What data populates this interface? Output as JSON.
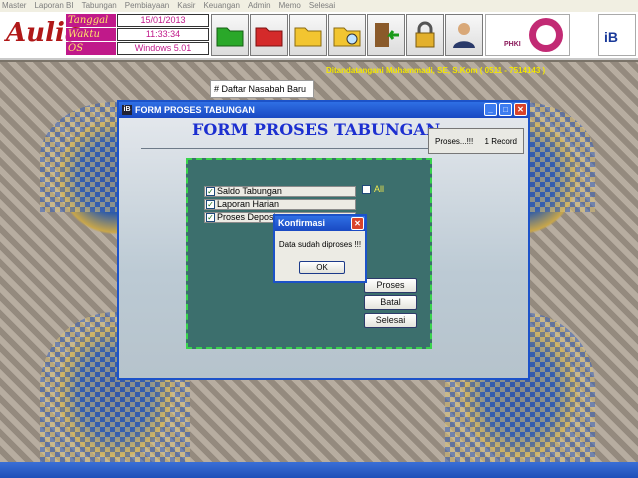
{
  "menubar": {
    "items": [
      "Master",
      "Laporan BI",
      "Tabungan",
      "Pembiayaan",
      "Kasir",
      "Keuangan",
      "Admin",
      "Memo",
      "Selesai"
    ]
  },
  "header": {
    "logo_text": "Aulia",
    "fields": [
      {
        "label": "Tanggal",
        "value": "15/01/2013"
      },
      {
        "label": "Waktu",
        "value": "11:33:34"
      },
      {
        "label": "OS",
        "value": "Windows 5.01"
      }
    ],
    "toolbar_icons": [
      "green-folder-icon",
      "red-folder-icon",
      "yellow-folder-icon",
      "search-folder-icon",
      "exit-door-icon",
      "lock-icon",
      "user-icon"
    ],
    "right_logos": [
      "PHKI",
      "iB"
    ],
    "status_text": "Ditandatangani Muhammadi, SE, S.Kom ( 0511 - 7514143 )"
  },
  "daftar_tooltip": "# Daftar Nasabah Baru",
  "window": {
    "title": "FORM PROSES TABUNGAN",
    "heading": "FORM PROSES TABUNGAN",
    "proses_box": {
      "left": "Proses...!!!",
      "right": "1 Record"
    },
    "checkboxes": [
      {
        "label": "Saldo Tabungan",
        "checked": true
      },
      {
        "label": "Laporan Harian",
        "checked": true
      },
      {
        "label": "Proses Deposito",
        "checked": true
      }
    ],
    "all_label": "All",
    "buttons": {
      "proses": "Proses",
      "batal": "Batal",
      "selesai": "Selesai"
    }
  },
  "dialog": {
    "title": "Konfirmasi",
    "message": "Data sudah diproses !!!",
    "ok": "OK"
  }
}
